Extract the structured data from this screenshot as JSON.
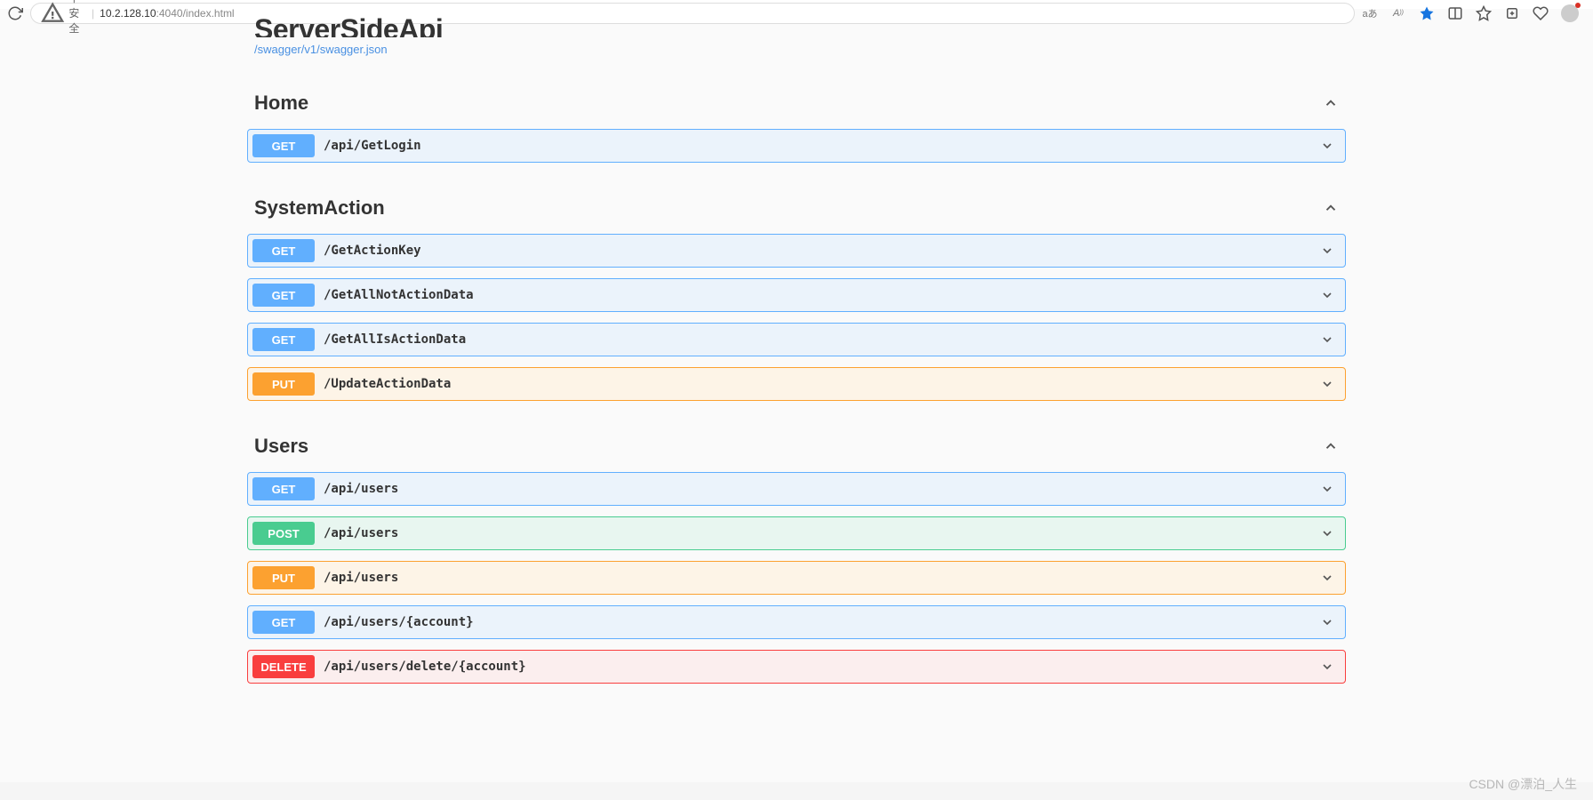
{
  "browser": {
    "insecure_label": "不安全",
    "url_host": "10.2.128.10",
    "url_port_path": ":4040/index.html",
    "translate_label": "aあ"
  },
  "header": {
    "title_partial": "ServerSideApi",
    "json_link": "/swagger/v1/swagger.json"
  },
  "sections": [
    {
      "name": "Home",
      "ops": [
        {
          "method": "GET",
          "path": "/api/GetLogin"
        }
      ]
    },
    {
      "name": "SystemAction",
      "ops": [
        {
          "method": "GET",
          "path": "/GetActionKey"
        },
        {
          "method": "GET",
          "path": "/GetAllNotActionData"
        },
        {
          "method": "GET",
          "path": "/GetAllIsActionData"
        },
        {
          "method": "PUT",
          "path": "/UpdateActionData"
        }
      ]
    },
    {
      "name": "Users",
      "ops": [
        {
          "method": "GET",
          "path": "/api/users"
        },
        {
          "method": "POST",
          "path": "/api/users"
        },
        {
          "method": "PUT",
          "path": "/api/users"
        },
        {
          "method": "GET",
          "path": "/api/users/{account}"
        },
        {
          "method": "DELETE",
          "path": "/api/users/delete/{account}"
        }
      ]
    }
  ],
  "watermark": "CSDN @漂泊_人生"
}
